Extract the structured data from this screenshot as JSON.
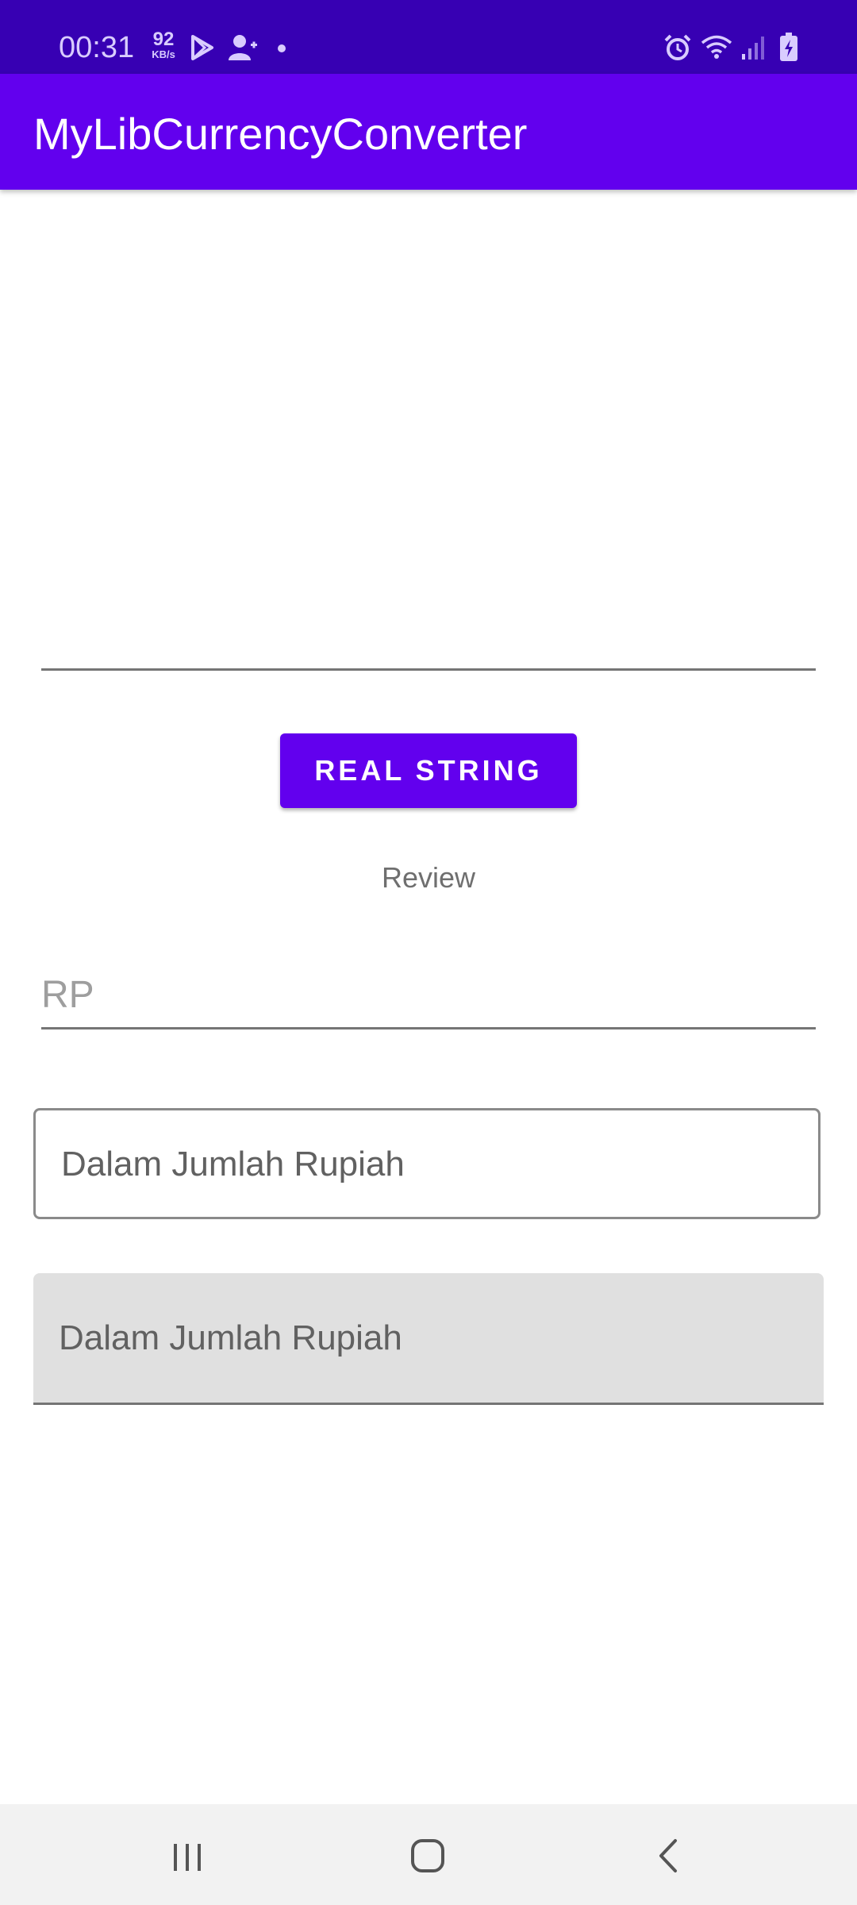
{
  "status_bar": {
    "time": "00:31",
    "net_speed_value": "92",
    "net_speed_unit": "KB/s",
    "left_icons": [
      "play-store-icon",
      "add-user-icon",
      "dot-icon"
    ],
    "right_icons": [
      "alarm-icon",
      "wifi-icon",
      "signal-icon",
      "battery-charging-icon"
    ]
  },
  "app_bar": {
    "title": "MyLibCurrencyConverter"
  },
  "main": {
    "top_input": {
      "value": "",
      "placeholder": ""
    },
    "convert_button_label": "REAL STRING",
    "review_text": "Review",
    "rp_input": {
      "value": "",
      "placeholder": "RP"
    },
    "outlined_field": {
      "hint": "Dalam Jumlah Rupiah"
    },
    "filled_field": {
      "hint": "Dalam Jumlah Rupiah"
    }
  },
  "nav_bar": {
    "buttons": [
      "recents-icon",
      "home-icon",
      "back-icon"
    ]
  },
  "colors": {
    "status_bar": "#3700B3",
    "primary": "#6200EE",
    "on_primary": "#FFFFFF",
    "hint_text": "#9E9E9E",
    "filled_background": "#E0E0E0"
  }
}
